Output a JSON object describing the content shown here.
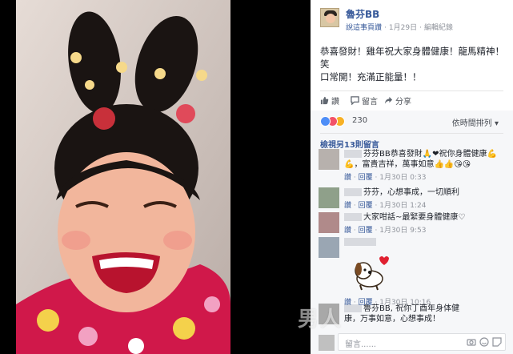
{
  "post": {
    "author": "魯芬BB",
    "link_label": "說這事頁讚",
    "date": "1月29日",
    "edit_history": "編輯紀錄",
    "text_line1": "恭喜發財！雞年祝大家身體健康！龍馬精神！笑",
    "text_line2": "口常開！充滿正能量！！",
    "like_label": "讚",
    "comment_label": "留言",
    "share_label": "分享"
  },
  "reactions": {
    "count": "230",
    "sort_label": "依時間排列 ▾",
    "more_comments": "檢視另13則留言"
  },
  "comments": [
    {
      "line1": "芬芬BB恭喜發財🙏❤祝你身體健康💪",
      "line2": "💪，富貴吉祥，萬事如意👍👍😘😘",
      "like": "讚",
      "reply": "回覆",
      "time": "1月30日 0:33"
    },
    {
      "line1": "芬芬，心想事成，一切順利",
      "like": "讚",
      "reply": "回覆",
      "time": "1月30日 1:24"
    },
    {
      "line1": "大家咁話~最緊要身體健康♡",
      "like": "讚",
      "reply": "回覆",
      "time": "1月30日 9:53"
    },
    {
      "like": "讚",
      "reply": "回覆",
      "time": "1月30日 10:16"
    },
    {
      "line1": "魯芬BB, 祝你丁酉年身体健",
      "line2": "康，万事如意，心想事成！"
    }
  ],
  "reply_box": {
    "placeholder": "留言......"
  },
  "watermark": "男人",
  "colors": {
    "link_blue": "#365899",
    "meta_gray": "#90949c",
    "like_blue": "#4e8ef7",
    "love_red": "#f25268",
    "haha_yellow": "#f7b125"
  },
  "icons": [
    "like-thumb-icon",
    "comment-bubble-icon",
    "share-arrow-icon",
    "like-reaction-icon",
    "love-reaction-icon",
    "haha-reaction-icon",
    "camera-icon",
    "emoji-icon",
    "sticker-icon"
  ]
}
